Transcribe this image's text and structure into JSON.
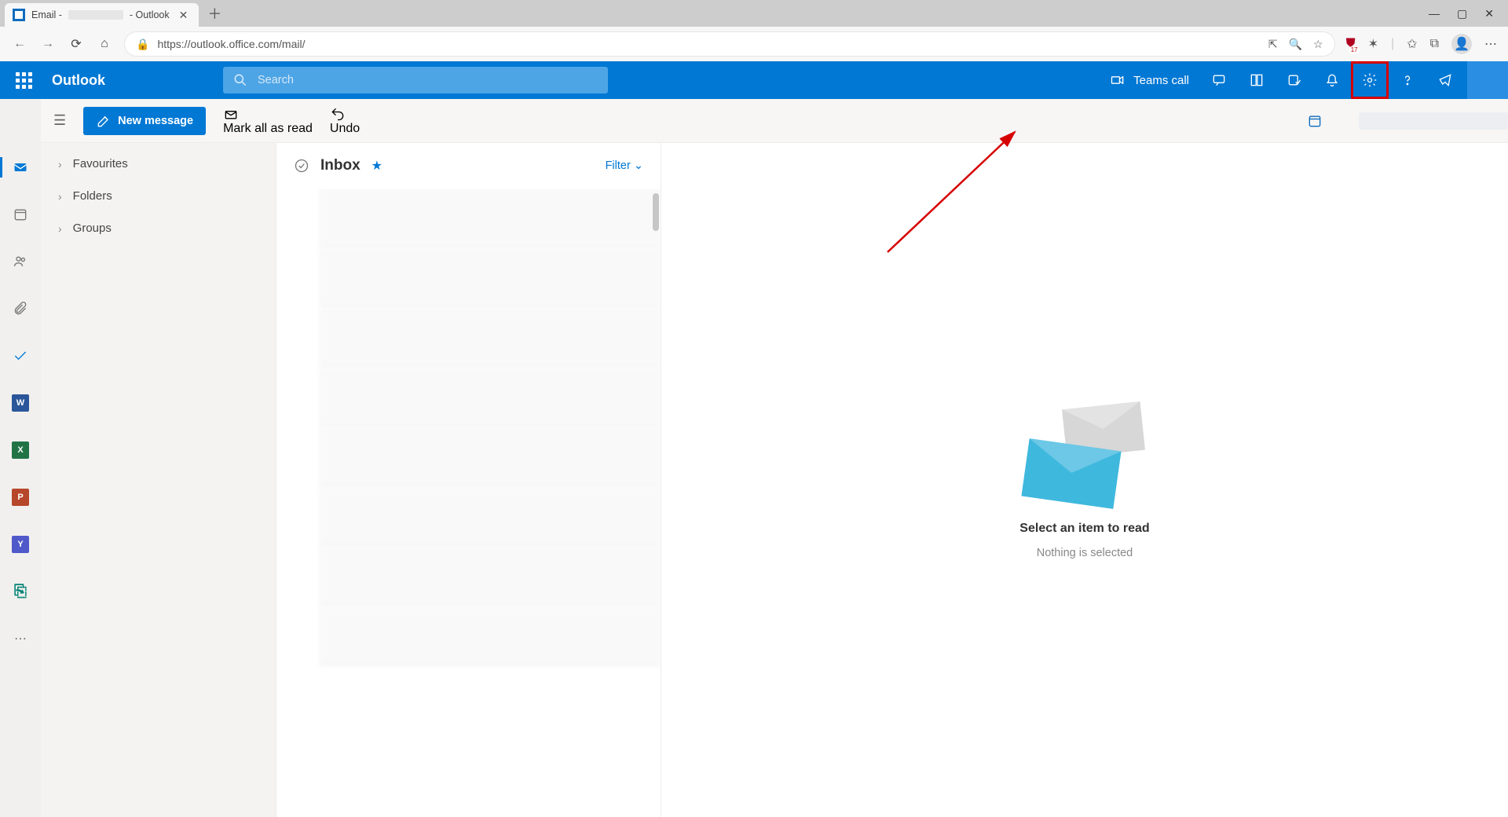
{
  "browser": {
    "tab_title_prefix": "Email - ",
    "tab_title_suffix": " - Outlook",
    "url": "https://outlook.office.com/mail/",
    "badge_count": "17"
  },
  "appbar": {
    "logo": "Outlook",
    "search_placeholder": "Search",
    "teams_call": "Teams call"
  },
  "toolbar": {
    "new_message": "New message",
    "mark_all": "Mark all as read",
    "undo": "Undo"
  },
  "nav": {
    "favourites": "Favourites",
    "folders": "Folders",
    "groups": "Groups"
  },
  "inbox": {
    "title": "Inbox",
    "filter": "Filter"
  },
  "reading": {
    "title": "Select an item to read",
    "subtitle": "Nothing is selected"
  }
}
